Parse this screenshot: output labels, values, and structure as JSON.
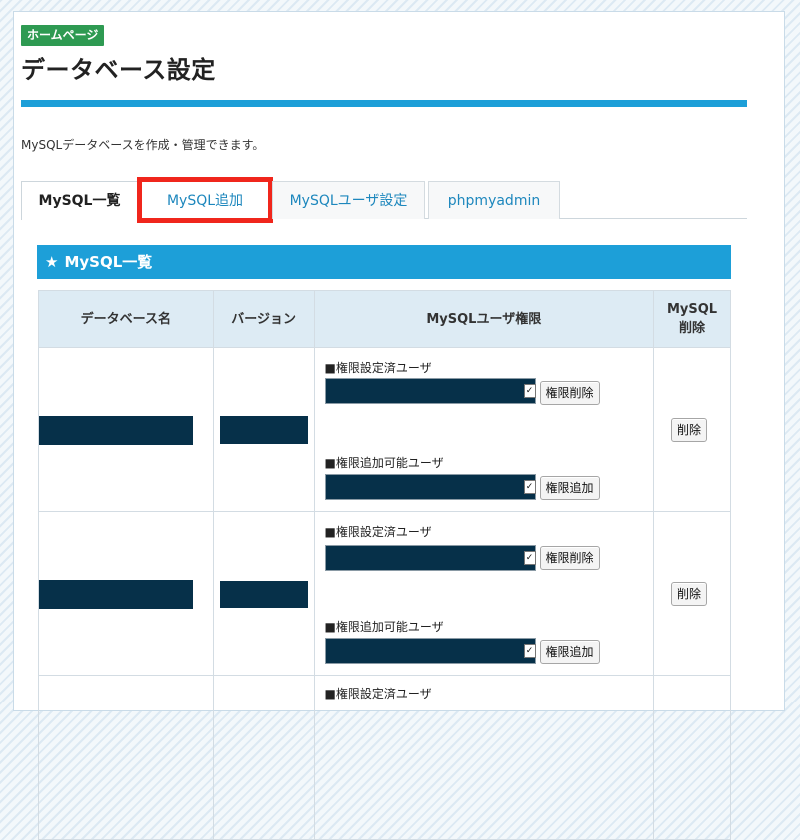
{
  "header": {
    "breadcrumb": "ホームページ",
    "title": "データベース設定",
    "description": "MySQLデータベースを作成・管理できます。"
  },
  "tabs": [
    {
      "label": "MySQL一覧",
      "active": true
    },
    {
      "label": "MySQL追加",
      "active": false,
      "highlighted": true
    },
    {
      "label": "MySQLユーザ設定",
      "active": false
    },
    {
      "label": "phpmyadmin",
      "active": false
    }
  ],
  "section": {
    "icon": "star-icon",
    "title": "MySQL一覧"
  },
  "table": {
    "columns": [
      "データベース名",
      "バージョン",
      "MySQLユーザ権限",
      "MySQL",
      "削除"
    ],
    "rows": [
      {
        "granted_label": "■権限設定済ユーザ",
        "revoke_button": "権限削除",
        "addable_label": "■権限追加可能ユーザ",
        "add_button": "権限追加",
        "delete_button": "削除"
      },
      {
        "granted_label": "■権限設定済ユーザ",
        "revoke_button": "権限削除",
        "addable_label": "■権限追加可能ユーザ",
        "add_button": "権限追加",
        "delete_button": "削除"
      },
      {
        "granted_label": "■権限設定済ユーザ"
      }
    ]
  },
  "colors": {
    "accent": "#1d9fd8",
    "breadcrumb": "#2e9a52",
    "highlight": "#f0261c",
    "redaction": "#063049"
  }
}
